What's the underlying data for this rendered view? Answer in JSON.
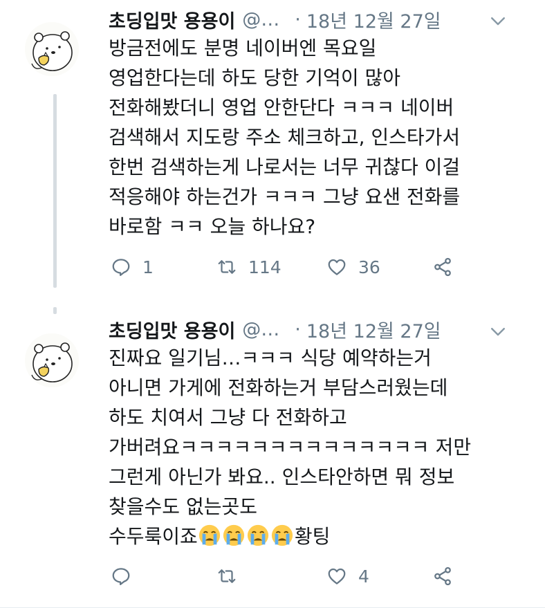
{
  "tweets": [
    {
      "author_name": "초딩입맛 용용이",
      "handle": "@…",
      "separator": "·",
      "date": "18년 12월 27일",
      "lines": [
        "방금전에도 분명 네이버엔 목요일",
        "영업한다는데 하도 당한 기억이 많아",
        "전화해봤더니 영업 안한단다 ㅋㅋㅋ 네이버",
        "검색해서 지도랑 주소 체크하고, 인스타가서",
        "한번 검색하는게 나로서는 너무 귀찮다 이걸",
        "적응해야 하는건가 ㅋㅋㅋ 그냥 요샌 전화를",
        "바로함 ㅋㅋ 오늘 하나요?"
      ],
      "reply_count": "1",
      "retweet_count": "114",
      "like_count": "36"
    },
    {
      "author_name": "초딩입맛 용용이",
      "handle": "@…",
      "separator": "·",
      "date": "18년 12월 27일",
      "lines": [
        "진짜요 일기님…ㅋㅋㅋ 식당 예약하는거",
        "아니면 가게에 전화하는거 부담스러웠는데",
        "하도 치여서 그냥 다 전화하고",
        "가버려요ㅋㅋㅋㅋㅋㅋㅋㅋㅋㅋㅋㅋㅋㅋ 저만",
        "그런게 아닌가 봐요.. 인스타안하면 뭐 정보",
        "찾을수도 없는곳도"
      ],
      "last_line_prefix": "수두룩이죠",
      "last_line_emoji": [
        "loudly-crying-face",
        "loudly-crying-face",
        "loudly-crying-face",
        "loudly-crying-face"
      ],
      "last_line_suffix": "황팅",
      "reply_count": "",
      "retweet_count": "",
      "like_count": "4"
    }
  ],
  "icons": {
    "reply": "reply-bubble-icon",
    "retweet": "retweet-arrows-icon",
    "like": "heart-outline-icon",
    "share": "share-nodes-icon",
    "more": "chevron-down-icon",
    "avatar": "bear-holding-food-avatar"
  },
  "colors": {
    "text": "#14171a",
    "secondary": "#657786",
    "thread_line": "#d6dce1",
    "divider": "#e6ecf0"
  }
}
